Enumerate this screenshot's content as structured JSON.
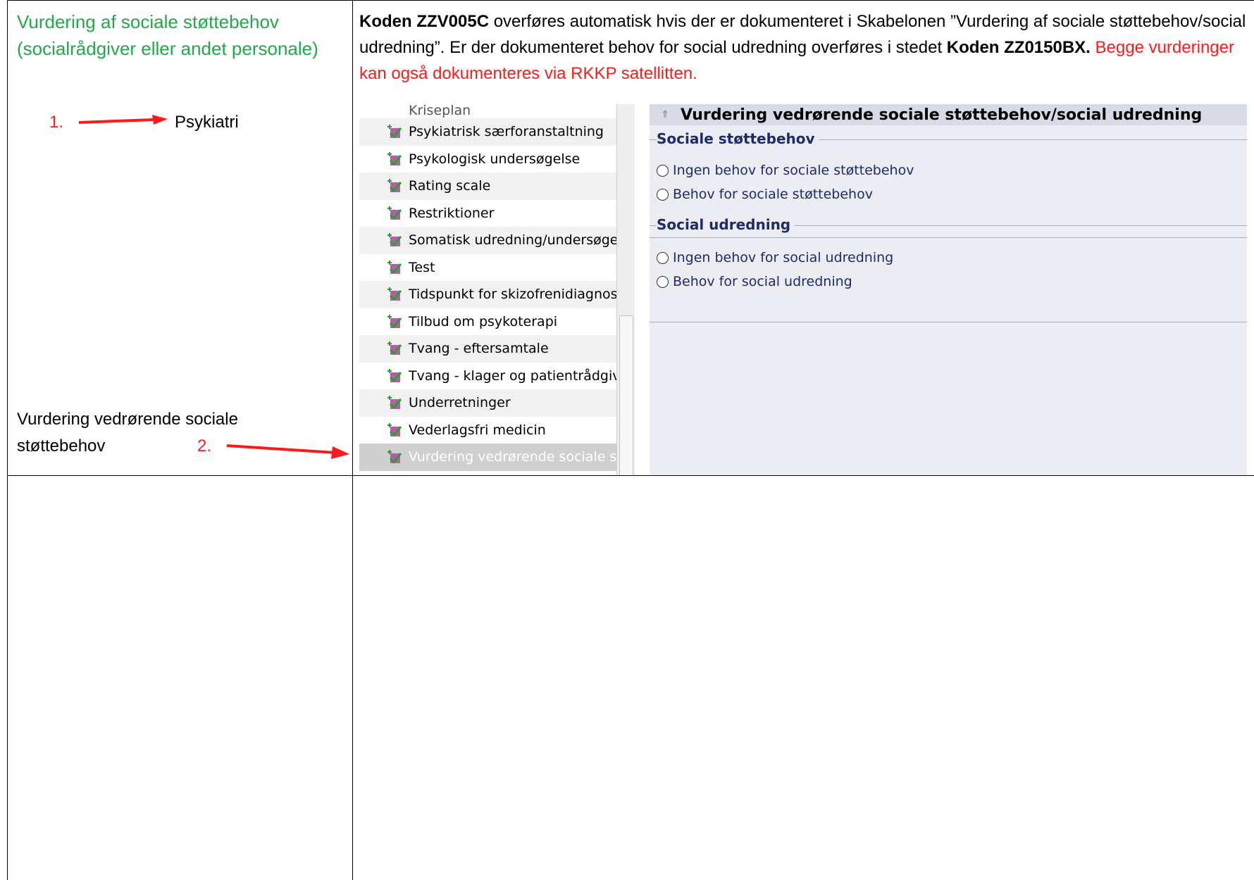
{
  "left_cell": {
    "title": "Vurdering af sociale støttebehov (socialrådgiver eller andet personale)",
    "step1_marker": "1.",
    "step1_label": "Psykiatri",
    "step2_text_line1": "Vurdering vedrørende sociale",
    "step2_text_line2": "støttebehov",
    "step2_marker": "2."
  },
  "description": {
    "code1": "Koden ZZV005C",
    "text1": " overføres automatisk hvis der er dokumenteret i Skabelonen ”Vurdering af sociale støttebehov/social udredning”. Er der dokumenteret behov for social udredning overføres i stedet ",
    "code2": "Koden ZZ0150BX.",
    "red_text": " Begge vurderinger kan også dokumenteres via RKKP satellitten."
  },
  "tree": {
    "cut_item": "Kriseplan",
    "items": [
      "Psykiatrisk særforanstaltning",
      "Psykologisk undersøgelse",
      "Rating scale",
      "Restriktioner",
      "Somatisk udredning/undersøgelse",
      "Test",
      "Tidspunkt for skizofrenidiagnose",
      "Tilbud om psykoterapi",
      "Tvang - eftersamtale",
      "Tvang - klager og patientrådgiver",
      "Underretninger",
      "Vederlagsfri medicin",
      "Vurdering vedrørende sociale støttebehov"
    ]
  },
  "form": {
    "header": "Vurdering vedrørende sociale støttebehov/social udredning",
    "group1_title": "Sociale støttebehov",
    "group1_options": [
      "Ingen behov for sociale støttebehov",
      "Behov for sociale støttebehov"
    ],
    "group2_title": "Social udredning",
    "group2_options": [
      "Ingen behov for social udredning",
      "Behov for social udredning"
    ]
  },
  "colors": {
    "green_title": "#22a84a",
    "red_marker": "#ff1a1a",
    "form_label_blue": "#1e2b6b"
  }
}
